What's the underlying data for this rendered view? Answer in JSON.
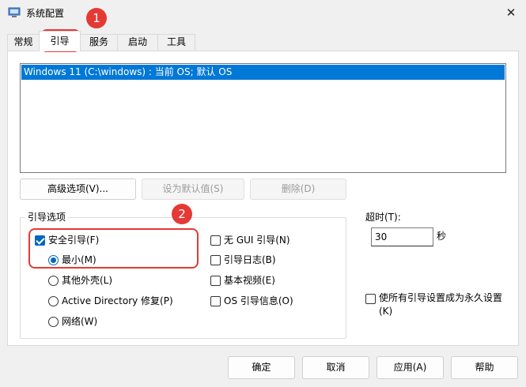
{
  "window": {
    "title": "系统配置",
    "close_glyph": "✕"
  },
  "tabs": [
    {
      "label": "常规"
    },
    {
      "label": "引导",
      "active": true
    },
    {
      "label": "服务"
    },
    {
      "label": "启动"
    },
    {
      "label": "工具"
    }
  ],
  "os_list": {
    "entries": [
      "Windows 11 (C:\\windows) : 当前 OS; 默认 OS"
    ]
  },
  "buttons": {
    "advanced": "高级选项(V)...",
    "set_default": "设为默认值(S)",
    "delete": "删除(D)"
  },
  "boot_options": {
    "label": "引导选项",
    "safe_boot": {
      "label": "安全引导(F)",
      "checked": true
    },
    "minimal": {
      "label": "最小(M)",
      "selected": true
    },
    "alternate_shell": {
      "label": "其他外壳(L)"
    },
    "active_directory": {
      "label": "Active Directory 修复(P)"
    },
    "network": {
      "label": "网络(W)"
    },
    "no_gui": {
      "label": "无 GUI 引导(N)",
      "checked": false
    },
    "boot_log": {
      "label": "引导日志(B)",
      "checked": false
    },
    "base_video": {
      "label": "基本视频(E)",
      "checked": false
    },
    "os_info": {
      "label": "OS 引导信息(O)",
      "checked": false
    }
  },
  "timeout": {
    "label": "超时(T):",
    "value": "30",
    "unit": "秒"
  },
  "permanent": {
    "label_line1": "使所有引导设置成为永久设置",
    "label_line2": "(K)",
    "checked": false
  },
  "footer": {
    "ok": "确定",
    "cancel": "取消",
    "apply": "应用(A)",
    "help": "帮助"
  },
  "annotations": {
    "badge1": "1",
    "badge2": "2"
  },
  "colors": {
    "accent": "#0067c0",
    "selection": "#0078d7",
    "annotation": "#e53935"
  }
}
